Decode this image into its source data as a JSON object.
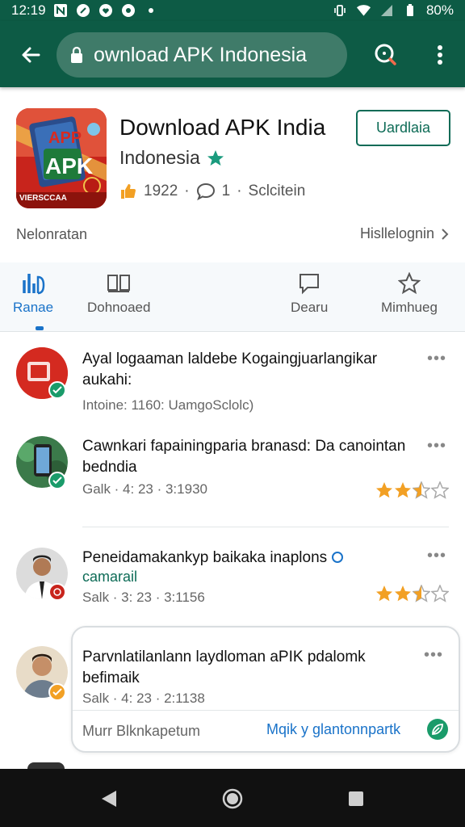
{
  "status": {
    "time": "12:19",
    "icons": [
      "n-icon",
      "chat-icon",
      "heart-icon",
      "record-icon",
      "dot-icon"
    ],
    "battery": "80%"
  },
  "urlbar": {
    "url_text": "ownload APK Indonesia"
  },
  "app": {
    "title": "Download APK India",
    "subtitle": "Indonesia",
    "install_label": "Uardlaia",
    "likes": "1922",
    "comments": "1",
    "comments_label": "Sclcitein",
    "icon_text_top": "APP",
    "icon_text_main": "APK",
    "icon_text_bottom": "VIERSCCAA",
    "info_left": "Nelonratan",
    "info_right": "Hisllelognin"
  },
  "tabs": [
    {
      "label": "Ranae",
      "icon": "stats-icon",
      "active": true
    },
    {
      "label": "Dohnoaed",
      "icon": "book-icon",
      "active": false
    },
    {
      "label": "Dearu",
      "icon": "comment-icon",
      "active": false
    },
    {
      "label": "Mimhueg",
      "icon": "star-icon",
      "active": false
    }
  ],
  "items": [
    {
      "title": "Ayal logaaman laldebe Kogaingjuarlangikar aukahi:",
      "meta": "Intoine: 1160: UamgoSclolc)",
      "rating": null
    },
    {
      "title": "Cawnkari fapainingparia branasd: Da canointan bedndia",
      "meta": "Galk · 4: 23 · 3:1930",
      "rating": 2.5
    },
    {
      "title": "Peneidamakankyp baikaka inaplons",
      "subline": "camarail",
      "meta": "Salk · 3: 23 · 3:1156",
      "rating": 2.5
    },
    {
      "title": "Parvnlatilanlann laydloman aPIK pdalomk befimaik",
      "meta": "Salk · 4: 23 · 2:1138",
      "footer_left": "Murr Blknkapetum",
      "footer_right": "Mqik y glantonnpartk"
    }
  ],
  "colors": {
    "brand": "#0d5b45",
    "accent": "#1a73c9",
    "star": "#f2a024"
  }
}
